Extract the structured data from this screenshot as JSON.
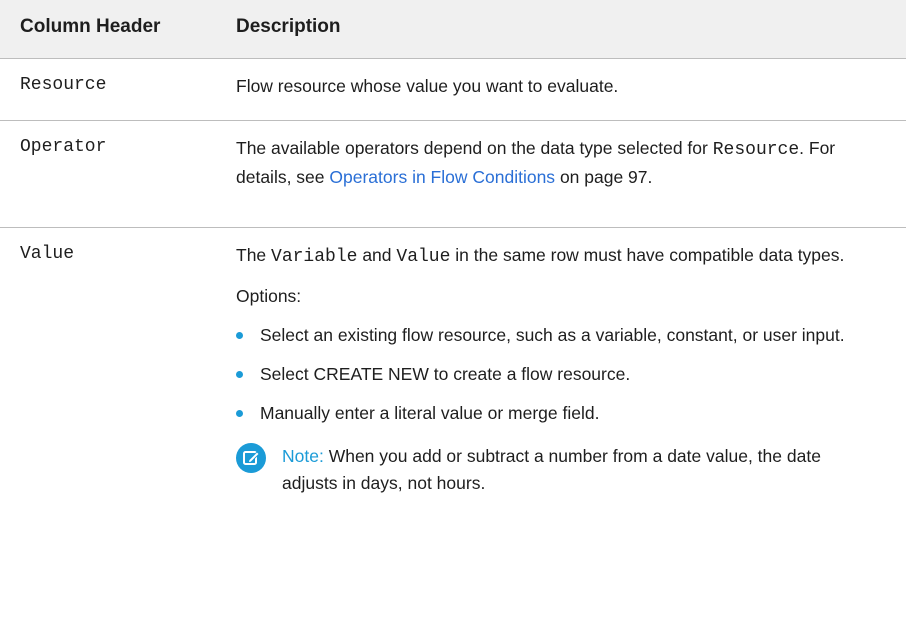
{
  "table": {
    "headers": {
      "col1": "Column Header",
      "col2": "Description"
    },
    "rows": [
      {
        "name": "Resource",
        "description": "Flow resource whose value you want to evaluate."
      },
      {
        "name": "Operator",
        "desc_prefix": "The available operators depend on the data type selected for",
        "desc_code": "Resource",
        "desc_mid": ". For details, see",
        "desc_link": "Operators in Flow Conditions",
        "desc_suffix": "on page 97."
      },
      {
        "name": "Value",
        "desc_pre": "The",
        "desc_code1": "Variable",
        "desc_and": "and",
        "desc_code2": "Value",
        "desc_post": "in the same row must have compatible data types.",
        "options_label": "Options:",
        "options": [
          "Select an existing flow resource, such as a variable, constant, or user input.",
          "Select CREATE NEW to create a flow resource.",
          "Manually enter a literal value or merge field."
        ],
        "note_label": "Note:",
        "note_text": "When you add or subtract a number from a date value, the date adjusts in days, not hours."
      }
    ]
  },
  "colors": {
    "accent": "#1b9bd7",
    "link": "#2a6fd6",
    "header_bg": "#f0f0f0"
  },
  "icons": {
    "note": "edit-note-icon",
    "bullet": "dot-bullet"
  }
}
